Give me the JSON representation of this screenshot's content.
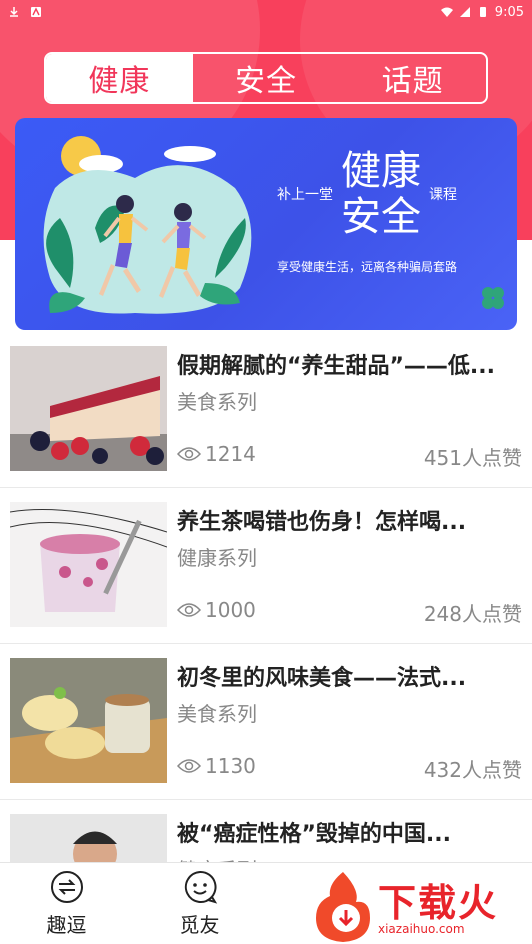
{
  "status_bar": {
    "time": "9:05"
  },
  "tabs": [
    {
      "label": "健康",
      "active": true
    },
    {
      "label": "安全",
      "active": false
    },
    {
      "label": "话题",
      "active": false
    }
  ],
  "banner": {
    "left_text": "补上一堂",
    "big_line1": "健康",
    "big_line2": "安全",
    "right_text": "课程",
    "subtitle": "享受健康生活，远离各种骗局套路"
  },
  "articles": [
    {
      "title": "假期解腻的“养生甜品”——低...",
      "category": "美食系列",
      "views": "1214",
      "likes": "451人点赞"
    },
    {
      "title": "养生茶喝错也伤身！怎样喝...",
      "category": "健康系列",
      "views": "1000",
      "likes": "248人点赞"
    },
    {
      "title": "初冬里的风味美食——法式...",
      "category": "美食系列",
      "views": "1130",
      "likes": "432人点赞"
    },
    {
      "title": "被“癌症性格”毁掉的中国...",
      "category": "健康系列",
      "views": "",
      "likes": ""
    }
  ],
  "bottom_nav": [
    {
      "label": "趣逗",
      "icon": "exchange-icon"
    },
    {
      "label": "觅友",
      "icon": "chat-icon"
    }
  ],
  "watermark": {
    "text": "下载火",
    "url": "xiazaihuo.com"
  },
  "colors": {
    "accent": "#f8405c",
    "banner": "#3d52e8",
    "watermark": "#e8242b"
  }
}
